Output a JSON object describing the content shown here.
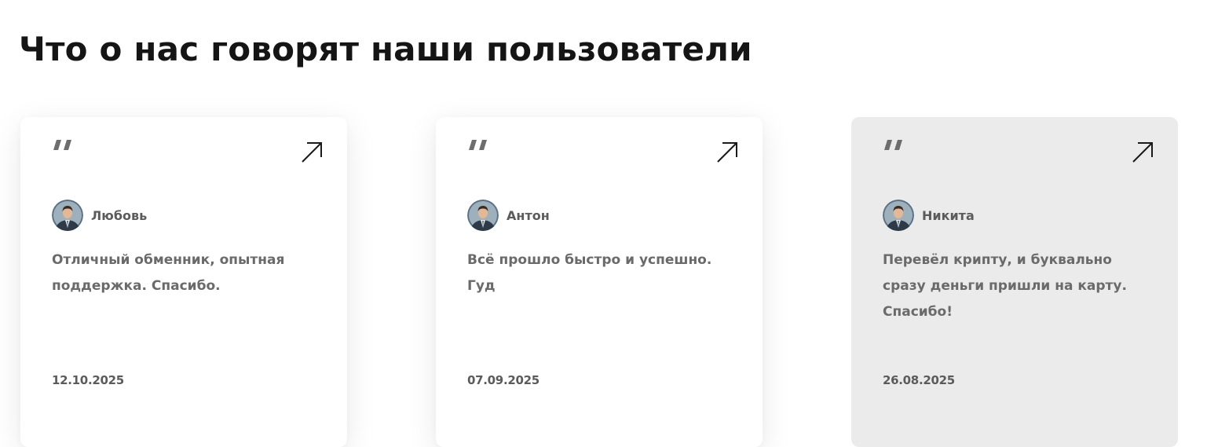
{
  "section": {
    "title": "Что о нас говорят наши пользователи"
  },
  "reviews": [
    {
      "author": "Любовь",
      "text": "Отличный обменник, опытная поддержка. Спасибо.",
      "date": "12.10.2025",
      "quote_icon": "quote-icon",
      "link_icon": "arrow-up-right-icon"
    },
    {
      "author": "Антон",
      "text": "Всё прошло быстро и успешно. Гуд",
      "date": "07.09.2025",
      "quote_icon": "quote-icon",
      "link_icon": "arrow-up-right-icon"
    },
    {
      "author": "Никита",
      "text": "Перевёл крипту, и буквально сразу деньги пришли на карту. Спасибо!",
      "date": "26.08.2025",
      "quote_icon": "quote-icon",
      "link_icon": "arrow-up-right-icon",
      "highlighted": true
    }
  ],
  "colors": {
    "card_background": "#ffffff",
    "card_highlighted_background": "#ebebeb",
    "title_text": "#151515",
    "body_text": "#6a6a6a",
    "quote_mark": "#6d6d6d"
  }
}
